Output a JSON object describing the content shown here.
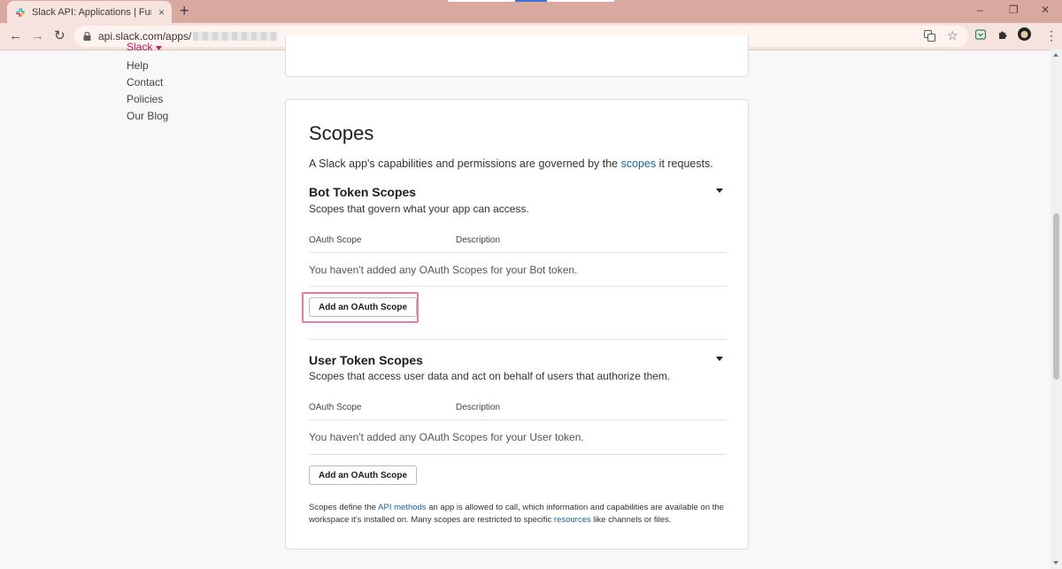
{
  "browser": {
    "tab_title": "Slack API: Applications | FunLock",
    "tab_close": "×",
    "new_tab": "+",
    "url": "api.slack.com/apps/",
    "window_controls": {
      "minimize": "–",
      "restore": "❐",
      "close": "✕"
    },
    "nav": {
      "back": "←",
      "forward": "→",
      "reload": "↻"
    },
    "accent": "#d9a89f"
  },
  "sidebar": {
    "slack_link": "Slack",
    "links": [
      "Help",
      "Contact",
      "Policies",
      "Our Blog"
    ]
  },
  "scopes": {
    "title": "Scopes",
    "intro_before": "A Slack app's capabilities and permissions are governed by the ",
    "intro_link": "scopes",
    "intro_after": " it requests.",
    "bot": {
      "title": "Bot Token Scopes",
      "description": "Scopes that govern what your app can access.",
      "col_scope": "OAuth Scope",
      "col_description": "Description",
      "empty": "You haven't added any OAuth Scopes for your Bot token.",
      "button": "Add an OAuth Scope"
    },
    "user": {
      "title": "User Token Scopes",
      "description": "Scopes that access user data and act on behalf of users that authorize them.",
      "col_scope": "OAuth Scope",
      "col_description": "Description",
      "empty": "You haven't added any OAuth Scopes for your User token.",
      "button": "Add an OAuth Scope"
    },
    "footnote": {
      "p1": "Scopes define the ",
      "link1": "API methods",
      "p2": " an app is allowed to call, which information and capabilities are available on the workspace it's installed on. Many scopes are restricted to specific ",
      "link2": "resources",
      "p3": " like channels or files."
    }
  }
}
